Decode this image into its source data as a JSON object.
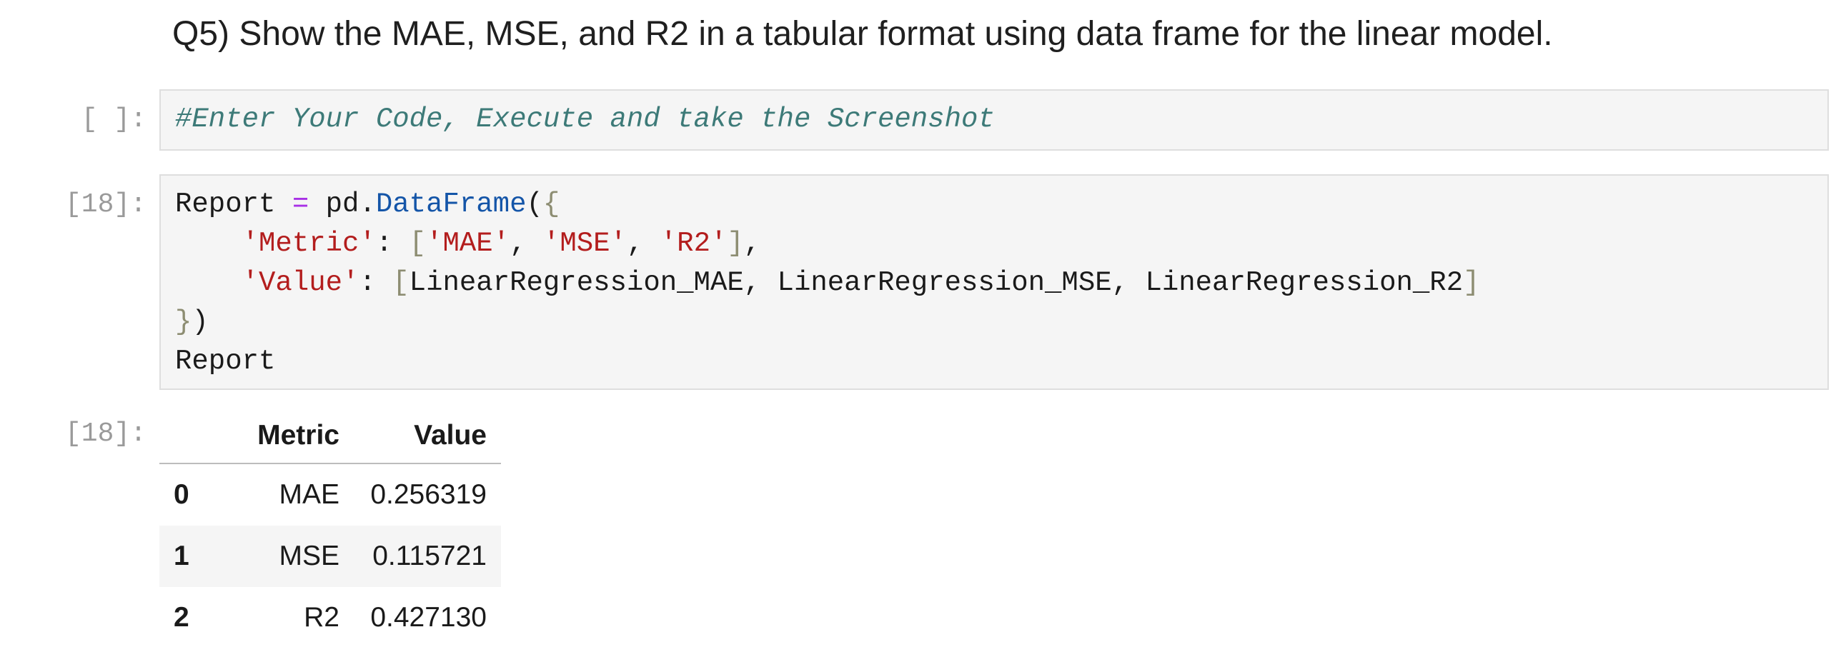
{
  "markdown": {
    "heading": "Q5) Show the MAE, MSE, and R2 in a tabular format using data frame for the linear model."
  },
  "cells": [
    {
      "prompt": "[ ]:",
      "lines": [
        [
          {
            "t": "#Enter Your Code, Execute and take the Screenshot",
            "k": "comment"
          }
        ]
      ]
    },
    {
      "prompt": "[18]:",
      "lines": [
        [
          {
            "t": "Report ",
            "k": "plain"
          },
          {
            "t": "=",
            "k": "op"
          },
          {
            "t": " pd.",
            "k": "plain"
          },
          {
            "t": "DataFrame",
            "k": "attr"
          },
          {
            "t": "(",
            "k": "plain"
          },
          {
            "t": "{",
            "k": "brk"
          }
        ],
        [
          {
            "t": "    ",
            "k": "plain"
          },
          {
            "t": "'Metric'",
            "k": "str"
          },
          {
            "t": ": ",
            "k": "plain"
          },
          {
            "t": "[",
            "k": "brk"
          },
          {
            "t": "'MAE'",
            "k": "str"
          },
          {
            "t": ", ",
            "k": "plain"
          },
          {
            "t": "'MSE'",
            "k": "str"
          },
          {
            "t": ", ",
            "k": "plain"
          },
          {
            "t": "'R2'",
            "k": "str"
          },
          {
            "t": "]",
            "k": "brk"
          },
          {
            "t": ",",
            "k": "plain"
          }
        ],
        [
          {
            "t": "    ",
            "k": "plain"
          },
          {
            "t": "'Value'",
            "k": "str"
          },
          {
            "t": ": ",
            "k": "plain"
          },
          {
            "t": "[",
            "k": "brk"
          },
          {
            "t": "LinearRegression_MAE, LinearRegression_MSE, LinearRegression_R2",
            "k": "plain"
          },
          {
            "t": "]",
            "k": "brk"
          }
        ],
        [
          {
            "t": "}",
            "k": "brk"
          },
          {
            "t": ")",
            "k": "plain"
          }
        ],
        [
          {
            "t": "Report",
            "k": "plain"
          }
        ]
      ]
    }
  ],
  "output": {
    "prompt": "[18]:",
    "columns": [
      "",
      "Metric",
      "Value"
    ],
    "rows": [
      {
        "index": "0",
        "metric": "MAE",
        "value": "0.256319"
      },
      {
        "index": "1",
        "metric": "MSE",
        "value": "0.115721"
      },
      {
        "index": "2",
        "metric": "R2",
        "value": "0.427130"
      }
    ]
  },
  "colors": {
    "prompt": "#9a9a9a",
    "cell_background": "#f5f5f5",
    "comment": "#3d7a78",
    "string": "#b31d1d",
    "operator": "#a831e6",
    "attribute": "#1455a8",
    "bracket": "#8d8d72"
  }
}
